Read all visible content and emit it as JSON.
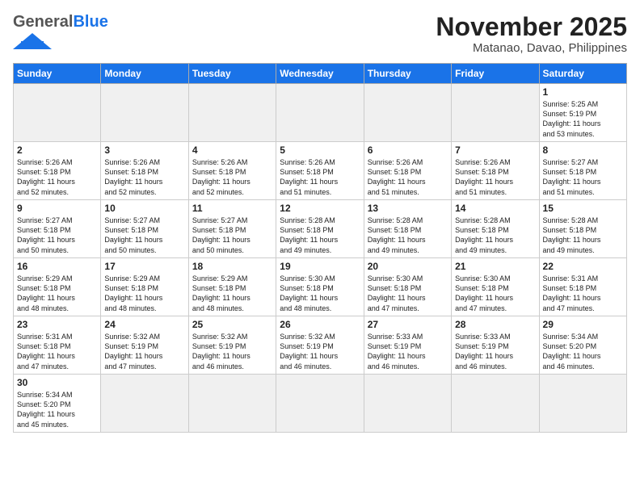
{
  "header": {
    "logo_general": "General",
    "logo_blue": "Blue",
    "month_title": "November 2025",
    "location": "Matanao, Davao, Philippines"
  },
  "weekdays": [
    "Sunday",
    "Monday",
    "Tuesday",
    "Wednesday",
    "Thursday",
    "Friday",
    "Saturday"
  ],
  "weeks": [
    [
      {
        "day": "",
        "info": ""
      },
      {
        "day": "",
        "info": ""
      },
      {
        "day": "",
        "info": ""
      },
      {
        "day": "",
        "info": ""
      },
      {
        "day": "",
        "info": ""
      },
      {
        "day": "",
        "info": ""
      },
      {
        "day": "1",
        "info": "Sunrise: 5:25 AM\nSunset: 5:19 PM\nDaylight: 11 hours\nand 53 minutes."
      }
    ],
    [
      {
        "day": "2",
        "info": "Sunrise: 5:26 AM\nSunset: 5:18 PM\nDaylight: 11 hours\nand 52 minutes."
      },
      {
        "day": "3",
        "info": "Sunrise: 5:26 AM\nSunset: 5:18 PM\nDaylight: 11 hours\nand 52 minutes."
      },
      {
        "day": "4",
        "info": "Sunrise: 5:26 AM\nSunset: 5:18 PM\nDaylight: 11 hours\nand 52 minutes."
      },
      {
        "day": "5",
        "info": "Sunrise: 5:26 AM\nSunset: 5:18 PM\nDaylight: 11 hours\nand 51 minutes."
      },
      {
        "day": "6",
        "info": "Sunrise: 5:26 AM\nSunset: 5:18 PM\nDaylight: 11 hours\nand 51 minutes."
      },
      {
        "day": "7",
        "info": "Sunrise: 5:26 AM\nSunset: 5:18 PM\nDaylight: 11 hours\nand 51 minutes."
      },
      {
        "day": "8",
        "info": "Sunrise: 5:27 AM\nSunset: 5:18 PM\nDaylight: 11 hours\nand 51 minutes."
      }
    ],
    [
      {
        "day": "9",
        "info": "Sunrise: 5:27 AM\nSunset: 5:18 PM\nDaylight: 11 hours\nand 50 minutes."
      },
      {
        "day": "10",
        "info": "Sunrise: 5:27 AM\nSunset: 5:18 PM\nDaylight: 11 hours\nand 50 minutes."
      },
      {
        "day": "11",
        "info": "Sunrise: 5:27 AM\nSunset: 5:18 PM\nDaylight: 11 hours\nand 50 minutes."
      },
      {
        "day": "12",
        "info": "Sunrise: 5:28 AM\nSunset: 5:18 PM\nDaylight: 11 hours\nand 49 minutes."
      },
      {
        "day": "13",
        "info": "Sunrise: 5:28 AM\nSunset: 5:18 PM\nDaylight: 11 hours\nand 49 minutes."
      },
      {
        "day": "14",
        "info": "Sunrise: 5:28 AM\nSunset: 5:18 PM\nDaylight: 11 hours\nand 49 minutes."
      },
      {
        "day": "15",
        "info": "Sunrise: 5:28 AM\nSunset: 5:18 PM\nDaylight: 11 hours\nand 49 minutes."
      }
    ],
    [
      {
        "day": "16",
        "info": "Sunrise: 5:29 AM\nSunset: 5:18 PM\nDaylight: 11 hours\nand 48 minutes."
      },
      {
        "day": "17",
        "info": "Sunrise: 5:29 AM\nSunset: 5:18 PM\nDaylight: 11 hours\nand 48 minutes."
      },
      {
        "day": "18",
        "info": "Sunrise: 5:29 AM\nSunset: 5:18 PM\nDaylight: 11 hours\nand 48 minutes."
      },
      {
        "day": "19",
        "info": "Sunrise: 5:30 AM\nSunset: 5:18 PM\nDaylight: 11 hours\nand 48 minutes."
      },
      {
        "day": "20",
        "info": "Sunrise: 5:30 AM\nSunset: 5:18 PM\nDaylight: 11 hours\nand 47 minutes."
      },
      {
        "day": "21",
        "info": "Sunrise: 5:30 AM\nSunset: 5:18 PM\nDaylight: 11 hours\nand 47 minutes."
      },
      {
        "day": "22",
        "info": "Sunrise: 5:31 AM\nSunset: 5:18 PM\nDaylight: 11 hours\nand 47 minutes."
      }
    ],
    [
      {
        "day": "23",
        "info": "Sunrise: 5:31 AM\nSunset: 5:18 PM\nDaylight: 11 hours\nand 47 minutes."
      },
      {
        "day": "24",
        "info": "Sunrise: 5:32 AM\nSunset: 5:19 PM\nDaylight: 11 hours\nand 47 minutes."
      },
      {
        "day": "25",
        "info": "Sunrise: 5:32 AM\nSunset: 5:19 PM\nDaylight: 11 hours\nand 46 minutes."
      },
      {
        "day": "26",
        "info": "Sunrise: 5:32 AM\nSunset: 5:19 PM\nDaylight: 11 hours\nand 46 minutes."
      },
      {
        "day": "27",
        "info": "Sunrise: 5:33 AM\nSunset: 5:19 PM\nDaylight: 11 hours\nand 46 minutes."
      },
      {
        "day": "28",
        "info": "Sunrise: 5:33 AM\nSunset: 5:19 PM\nDaylight: 11 hours\nand 46 minutes."
      },
      {
        "day": "29",
        "info": "Sunrise: 5:34 AM\nSunset: 5:20 PM\nDaylight: 11 hours\nand 46 minutes."
      }
    ],
    [
      {
        "day": "30",
        "info": "Sunrise: 5:34 AM\nSunset: 5:20 PM\nDaylight: 11 hours\nand 45 minutes."
      },
      {
        "day": "",
        "info": ""
      },
      {
        "day": "",
        "info": ""
      },
      {
        "day": "",
        "info": ""
      },
      {
        "day": "",
        "info": ""
      },
      {
        "day": "",
        "info": ""
      },
      {
        "day": "",
        "info": ""
      }
    ]
  ]
}
